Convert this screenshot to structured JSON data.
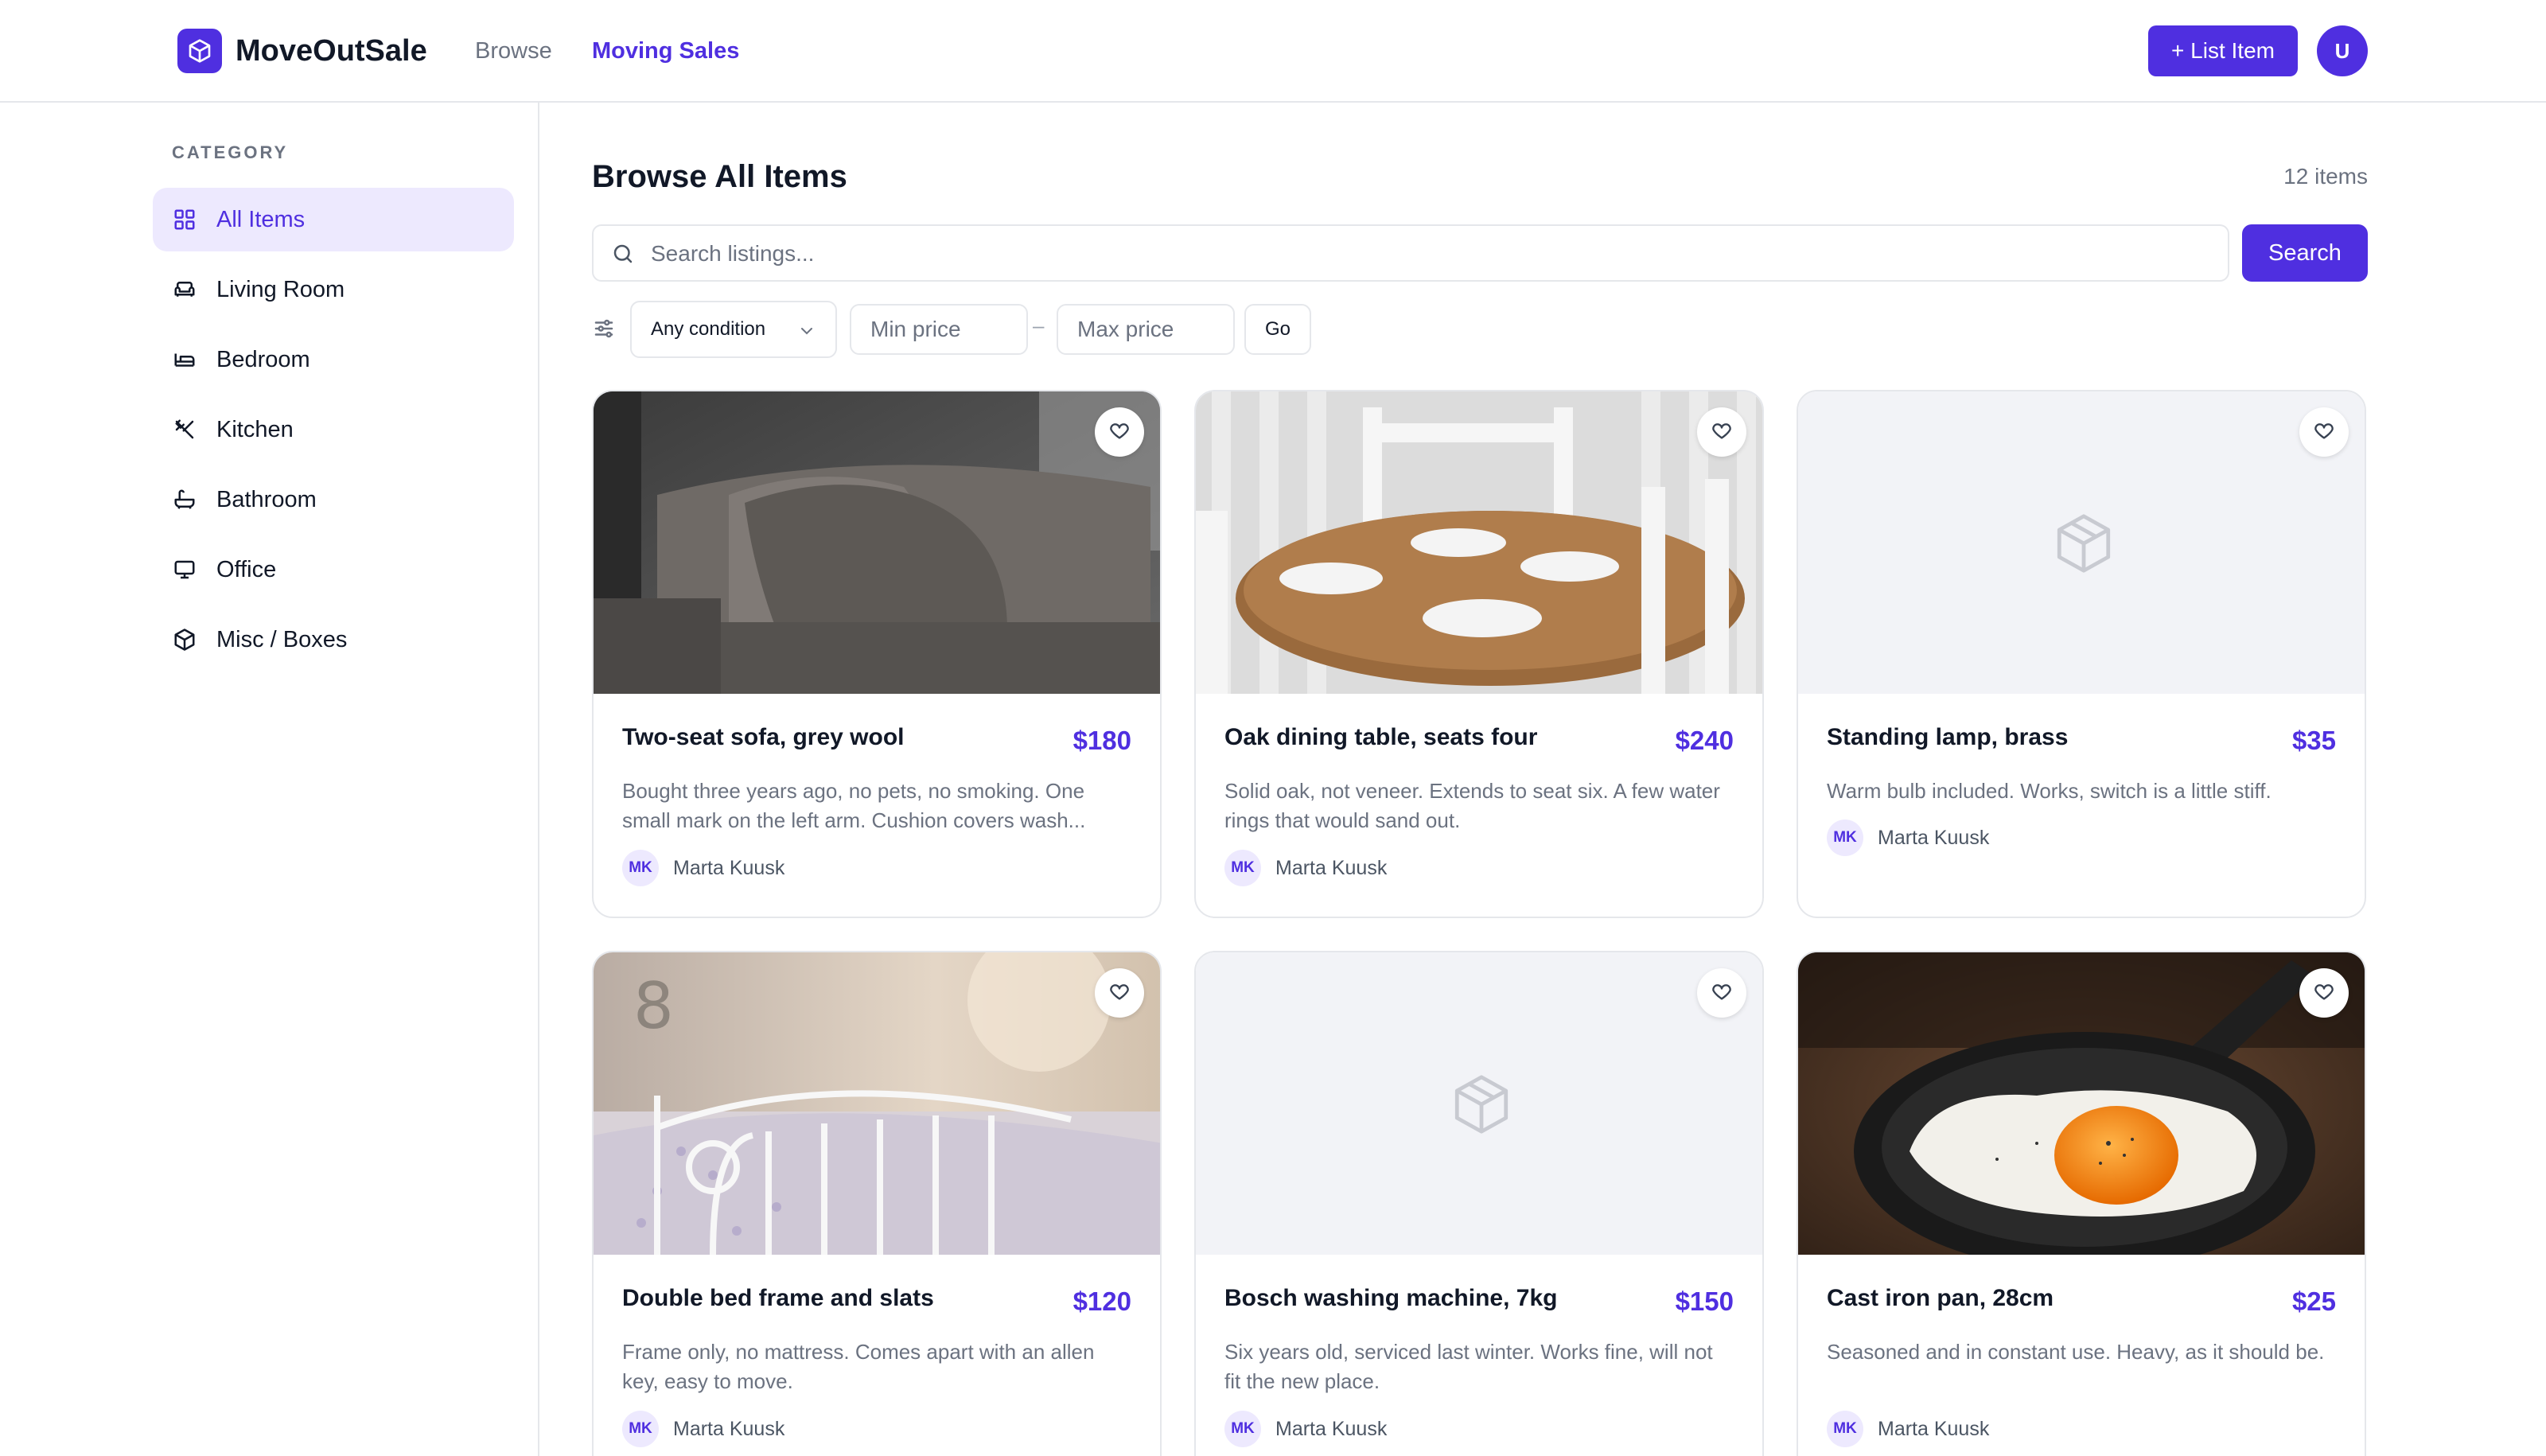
{
  "header": {
    "brand": "MoveOutSale",
    "nav": [
      {
        "label": "Browse",
        "active": false
      },
      {
        "label": "Moving Sales",
        "active": true
      }
    ],
    "list_button": "+ List Item",
    "user_initial": "U",
    "accent_color": "#4f2fe0"
  },
  "sidebar": {
    "heading": "CATEGORY",
    "items": [
      {
        "label": "All Items",
        "icon": "grid-icon",
        "active": true
      },
      {
        "label": "Living Room",
        "icon": "sofa-icon",
        "active": false
      },
      {
        "label": "Bedroom",
        "icon": "bed-icon",
        "active": false
      },
      {
        "label": "Kitchen",
        "icon": "utensils-icon",
        "active": false
      },
      {
        "label": "Bathroom",
        "icon": "bath-icon",
        "active": false
      },
      {
        "label": "Office",
        "icon": "monitor-icon",
        "active": false
      },
      {
        "label": "Misc / Boxes",
        "icon": "box-icon",
        "active": false
      }
    ]
  },
  "main": {
    "title": "Browse All Items",
    "count": "12 items",
    "search": {
      "placeholder": "Search listings...",
      "button": "Search"
    },
    "filters": {
      "condition": "Any condition",
      "min_placeholder": "Min price",
      "separator": "–",
      "max_placeholder": "Max price",
      "go": "Go"
    },
    "listings": [
      {
        "title": "Two-seat sofa, grey wool",
        "price": "$180",
        "desc": "Bought three years ago, no pets, no smoking. One small mark on the left arm. Cushion covers wash...",
        "seller_initials": "MK",
        "seller": "Marta Kuusk",
        "image": "sofa-photo"
      },
      {
        "title": "Oak dining table, seats four",
        "price": "$240",
        "desc": "Solid oak, not veneer. Extends to seat six. A few water rings that would sand out.",
        "seller_initials": "MK",
        "seller": "Marta Kuusk",
        "image": "table-photo"
      },
      {
        "title": "Standing lamp, brass",
        "price": "$35",
        "desc": "Warm bulb included. Works, switch is a little stiff.",
        "seller_initials": "MK",
        "seller": "Marta Kuusk",
        "image": "placeholder-box-icon"
      },
      {
        "title": "Double bed frame and slats",
        "price": "$120",
        "desc": "Frame only, no mattress. Comes apart with an allen key, easy to move.",
        "seller_initials": "MK",
        "seller": "Marta Kuusk",
        "image": "bed-photo"
      },
      {
        "title": "Bosch washing machine, 7kg",
        "price": "$150",
        "desc": "Six years old, serviced last winter. Works fine, will not fit the new place.",
        "seller_initials": "MK",
        "seller": "Marta Kuusk",
        "image": "placeholder-box-icon"
      },
      {
        "title": "Cast iron pan, 28cm",
        "price": "$25",
        "desc": "Seasoned and in constant use. Heavy, as it should be.",
        "seller_initials": "MK",
        "seller": "Marta Kuusk",
        "image": "pan-photo"
      }
    ]
  }
}
